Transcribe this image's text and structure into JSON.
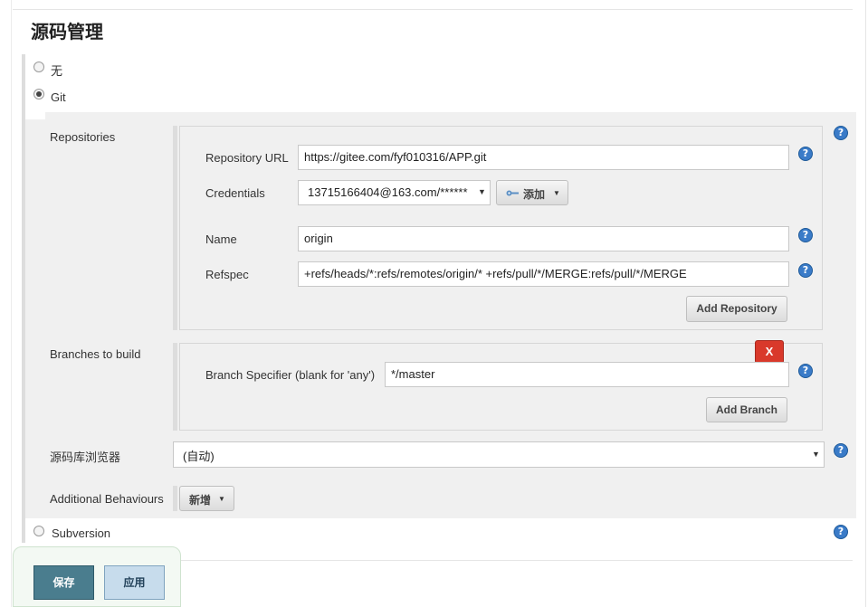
{
  "section": {
    "title": "源码管理"
  },
  "scm_options": {
    "none_label": "无",
    "git_label": "Git",
    "subversion_label": "Subversion"
  },
  "repositories": {
    "label": "Repositories",
    "url_label": "Repository URL",
    "url_value": "https://gitee.com/fyf010316/APP.git",
    "credentials_label": "Credentials",
    "credentials_value": "13715166404@163.com/******",
    "add_label": "添加",
    "name_label": "Name",
    "name_value": "origin",
    "refspec_label": "Refspec",
    "refspec_value": "+refs/heads/*:refs/remotes/origin/* +refs/pull/*/MERGE:refs/pull/*/MERGE",
    "add_repository_label": "Add Repository"
  },
  "branches": {
    "label": "Branches to build",
    "delete_label": "X",
    "specifier_label": "Branch Specifier (blank for 'any')",
    "specifier_value": "*/master",
    "add_branch_label": "Add Branch"
  },
  "browser": {
    "label": "源码库浏览器",
    "value": "(自动)"
  },
  "behaviours": {
    "label": "Additional Behaviours",
    "add_label": "新增"
  },
  "help_glyph": "?",
  "footer": {
    "save_label": "保存",
    "apply_label": "应用"
  },
  "colors": {
    "help_icon": "#3a7bc8",
    "delete_button": "#d9392b",
    "save_button": "#4a7d8e",
    "apply_button": "#c7dcec",
    "panel_bg": "#f0f0f0"
  },
  "icons": {
    "help": "question-circle-icon",
    "credentials": "key-icon",
    "dropdown": "caret-down-icon"
  }
}
